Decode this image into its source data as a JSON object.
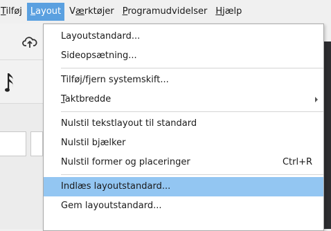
{
  "menubar": {
    "items": [
      {
        "pre": "",
        "mn": "T",
        "post": "ilføj"
      },
      {
        "pre": "",
        "mn": "L",
        "post": "ayout"
      },
      {
        "pre": "V",
        "mn": "æ",
        "post": "rktøjer"
      },
      {
        "pre": "",
        "mn": "P",
        "post": "rogramudvidelser"
      },
      {
        "pre": "",
        "mn": "H",
        "post": "jælp"
      }
    ]
  },
  "layout_menu": {
    "items": [
      {
        "label": "Layoutstandard..."
      },
      {
        "label": "Sideopsætning..."
      },
      {
        "label": "Tilføj/fjern systemskift..."
      },
      {
        "mn": "T",
        "label": "aktbredde"
      },
      {
        "label": "Nulstil tekstlayout til standard"
      },
      {
        "label": "Nulstil bjælker"
      },
      {
        "label": "Nulstil former og placeringer",
        "shortcut": "Ctrl+R"
      },
      {
        "label": "Indlæs layoutstandard..."
      },
      {
        "label": "Gem layoutstandard..."
      }
    ]
  },
  "colors": {
    "active_menu": "#5aa0e0",
    "highlight": "#93c6f2"
  },
  "icons": [
    "cloud-upload-icon",
    "music-note-icon",
    "submenu-arrow-icon"
  ]
}
